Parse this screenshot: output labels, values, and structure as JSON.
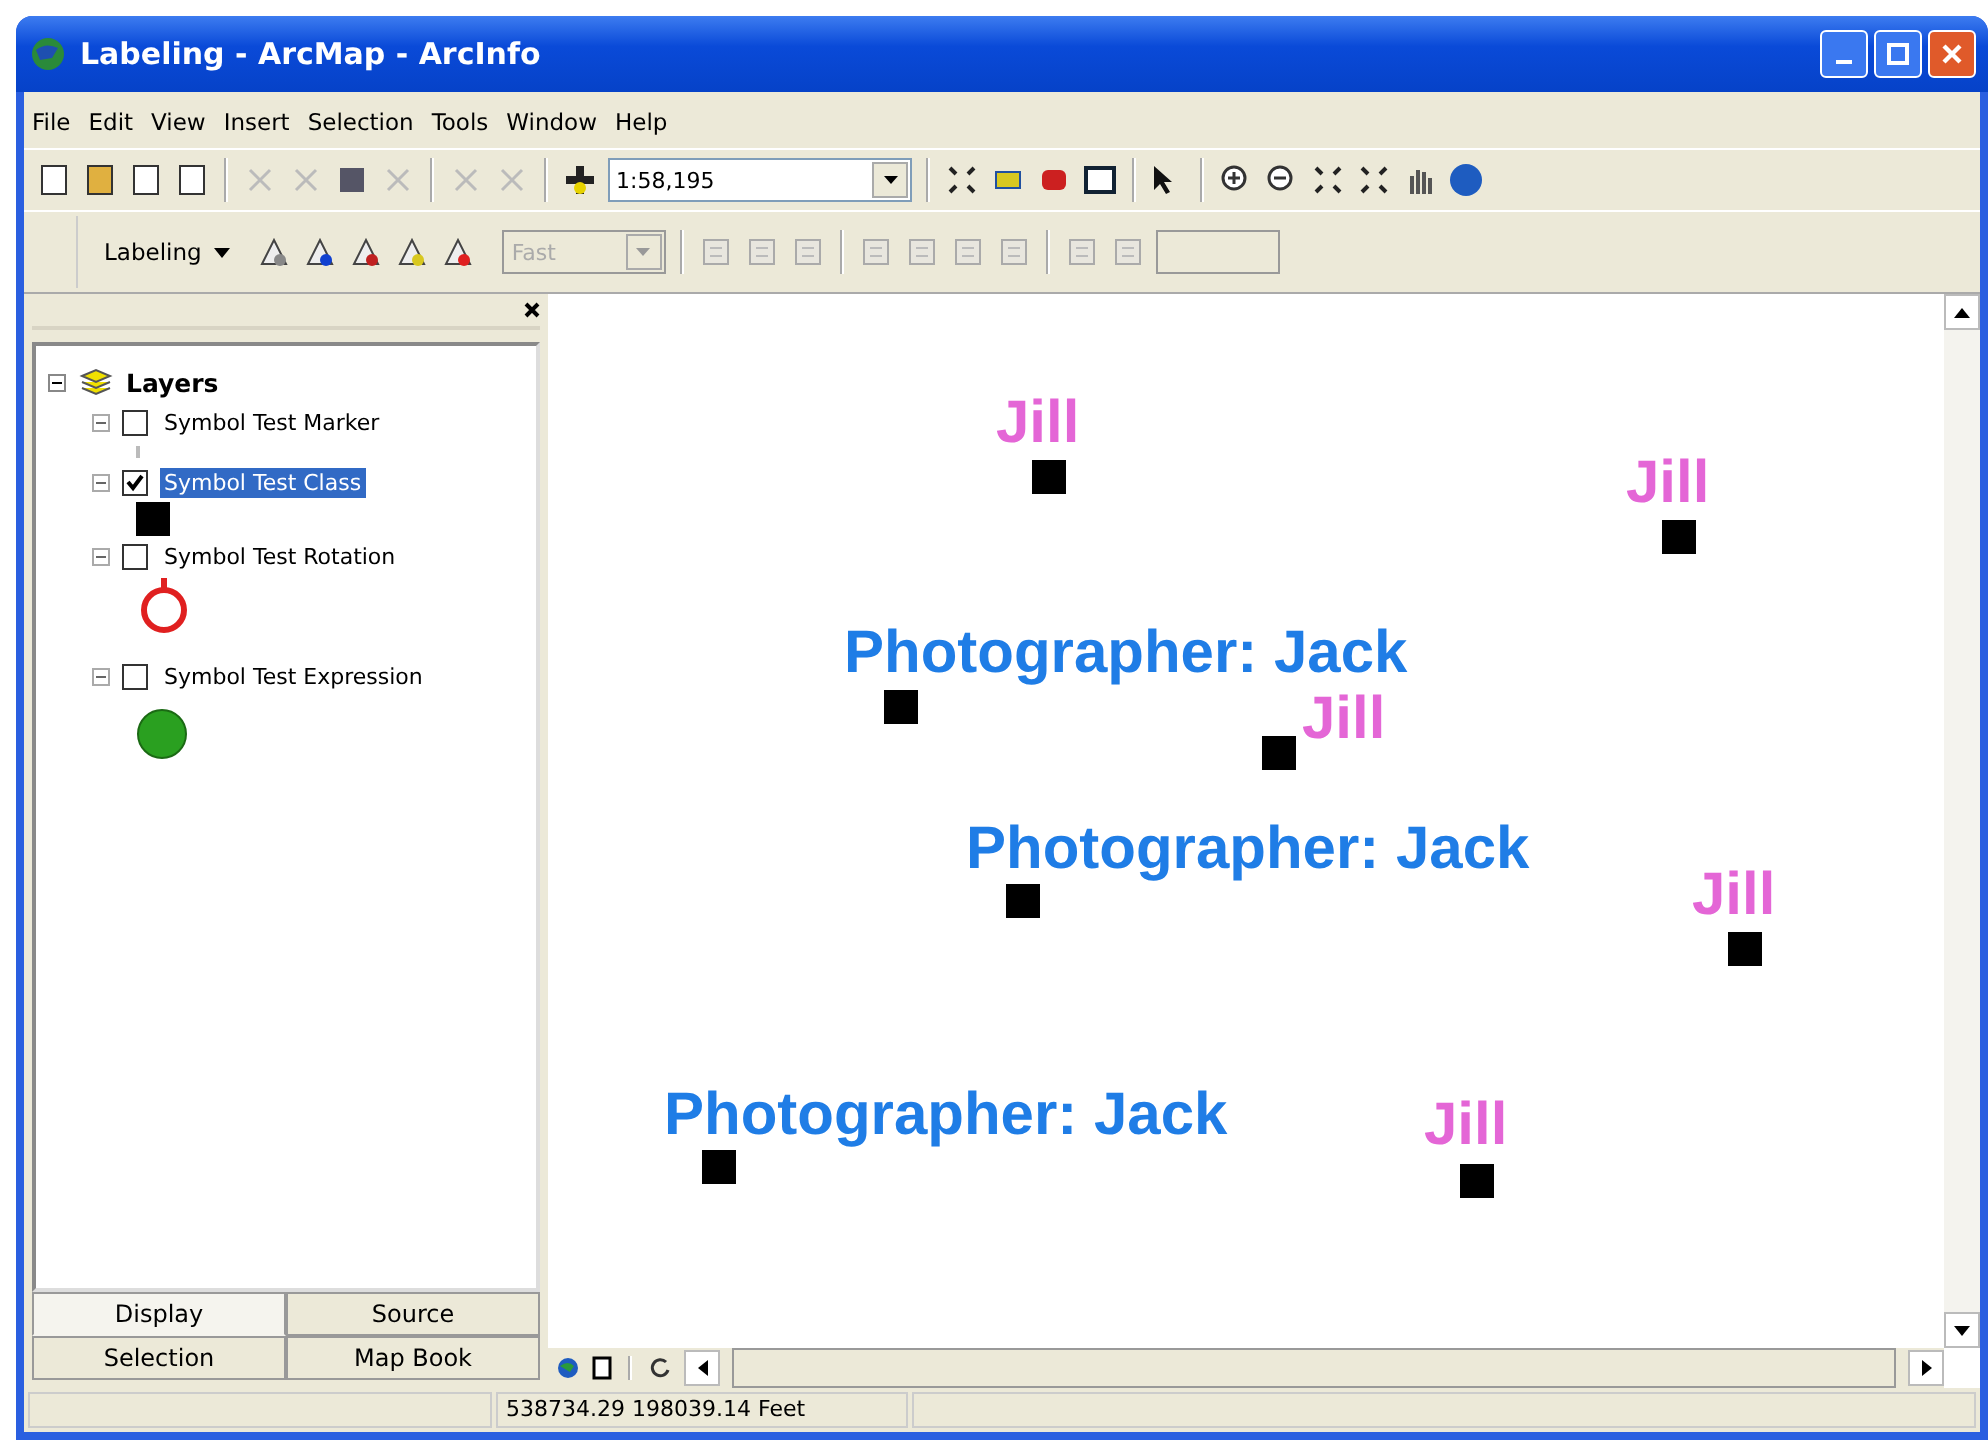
{
  "window": {
    "title": "Labeling - ArcMap - ArcInfo"
  },
  "menu": [
    "File",
    "Edit",
    "View",
    "Insert",
    "Selection",
    "Tools",
    "Window",
    "Help"
  ],
  "standard_toolbar": {
    "scale": "1:58,195"
  },
  "labeling_toolbar": {
    "title": "Labeling",
    "mode": {
      "value": "Fast",
      "disabled": true
    }
  },
  "toc": {
    "root": {
      "label": "Layers",
      "expanded": true,
      "children": [
        {
          "label": "Symbol Test Marker",
          "checked": false,
          "selected": false,
          "kind": "dot"
        },
        {
          "label": "Symbol Test Class",
          "checked": true,
          "selected": true,
          "kind": "square"
        },
        {
          "label": "Symbol Test Rotation",
          "checked": false,
          "selected": false,
          "kind": "ring"
        },
        {
          "label": "Symbol Test Expression",
          "checked": false,
          "selected": false,
          "kind": "disc"
        }
      ]
    },
    "tabs": [
      {
        "label": "Display",
        "selected": true
      },
      {
        "label": "Source",
        "selected": false
      },
      {
        "label": "Selection",
        "selected": false
      },
      {
        "label": "Map Book",
        "selected": false
      }
    ]
  },
  "map": {
    "features": [
      {
        "label": "Jill",
        "color": "#e466d6"
      },
      {
        "label": "Jill",
        "color": "#e466d6"
      },
      {
        "label": "Photographer: Jack",
        "color": "#1f7de6"
      },
      {
        "label": "Jill",
        "color": "#e466d6"
      },
      {
        "label": "Photographer: Jack",
        "color": "#1f7de6"
      },
      {
        "label": "Jill",
        "color": "#e466d6"
      },
      {
        "label": "Photographer: Jack",
        "color": "#1f7de6"
      },
      {
        "label": "Jill",
        "color": "#e466d6"
      }
    ]
  },
  "status_bar": {
    "coordinates": "538734.29 198039.14 Feet"
  }
}
